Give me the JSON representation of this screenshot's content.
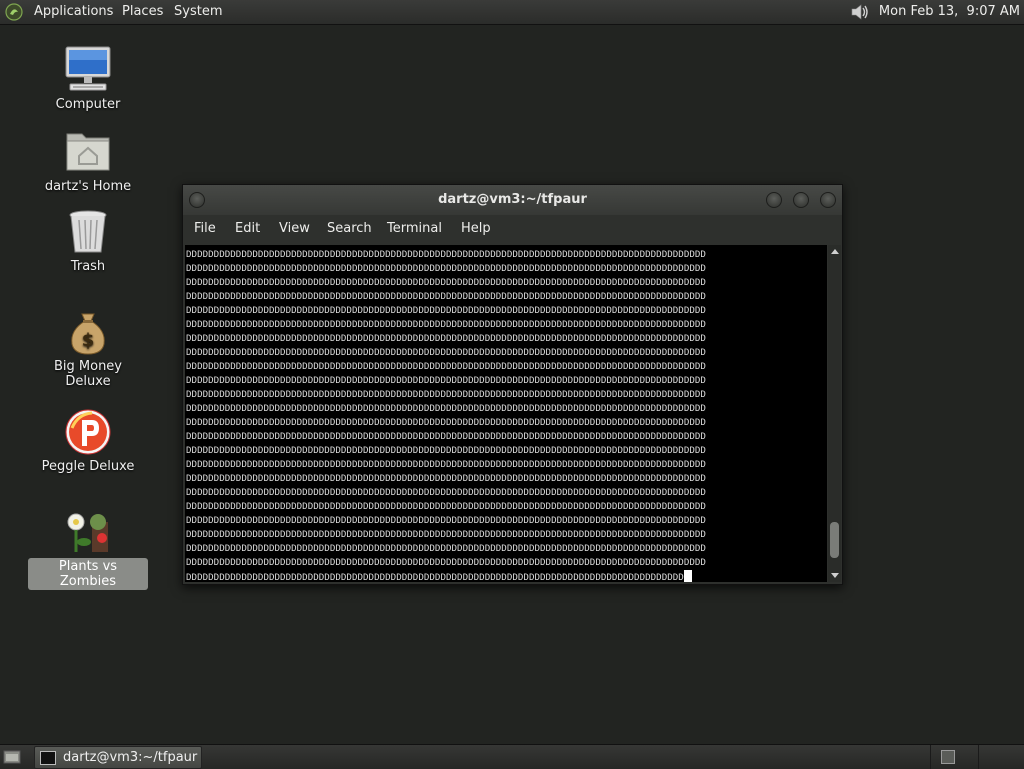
{
  "top_panel": {
    "menus": [
      "Applications",
      "Places",
      "System"
    ],
    "clock": "Mon Feb 13,  9:07 AM",
    "icons": [
      "gnome-foot-icon",
      "speaker-volume-icon"
    ]
  },
  "desktop": {
    "icons": [
      {
        "label": "Computer",
        "icon": "computer-icon"
      },
      {
        "label": "dartz's Home",
        "icon": "home-folder-icon"
      },
      {
        "label": "Trash",
        "icon": "trash-icon"
      },
      {
        "label": "Big Money Deluxe",
        "icon": "money-bag-icon"
      },
      {
        "label": "Peggle Deluxe",
        "icon": "peggle-icon"
      },
      {
        "label": "Plants vs Zombies",
        "icon": "plants-vs-zombies-icon",
        "selected": true
      }
    ]
  },
  "terminal": {
    "title": "dartz@vm3:~/tfpaur",
    "menu": [
      "File",
      "Edit",
      "View",
      "Search",
      "Terminal",
      "Help"
    ],
    "line_text": "DDDDDDDDDDDDDDDDDDDDDDDDDDDDDDDDDDDDDDDDDDDDDDDDDDDDDDDDDDDDDDDDDDDDDDDDDDDDDDDDDDDDDDDDDDDDDD",
    "last_line_text": "DDDDDDDDDDDDDDDDDDDDDDDDDDDDDDDDDDDDDDDDDDDDDDDDDDDDDDDDDDDDDDDDDDDDDDDDDDDDDDDDDDDDDDDDDD",
    "line_count": 24,
    "scroll_position": 0.95
  },
  "bottom_panel": {
    "task_label": "dartz@vm3:~/tfpaur",
    "icons": [
      "show-desktop-icon",
      "terminal-icon",
      "workspace-switcher-icon"
    ]
  }
}
